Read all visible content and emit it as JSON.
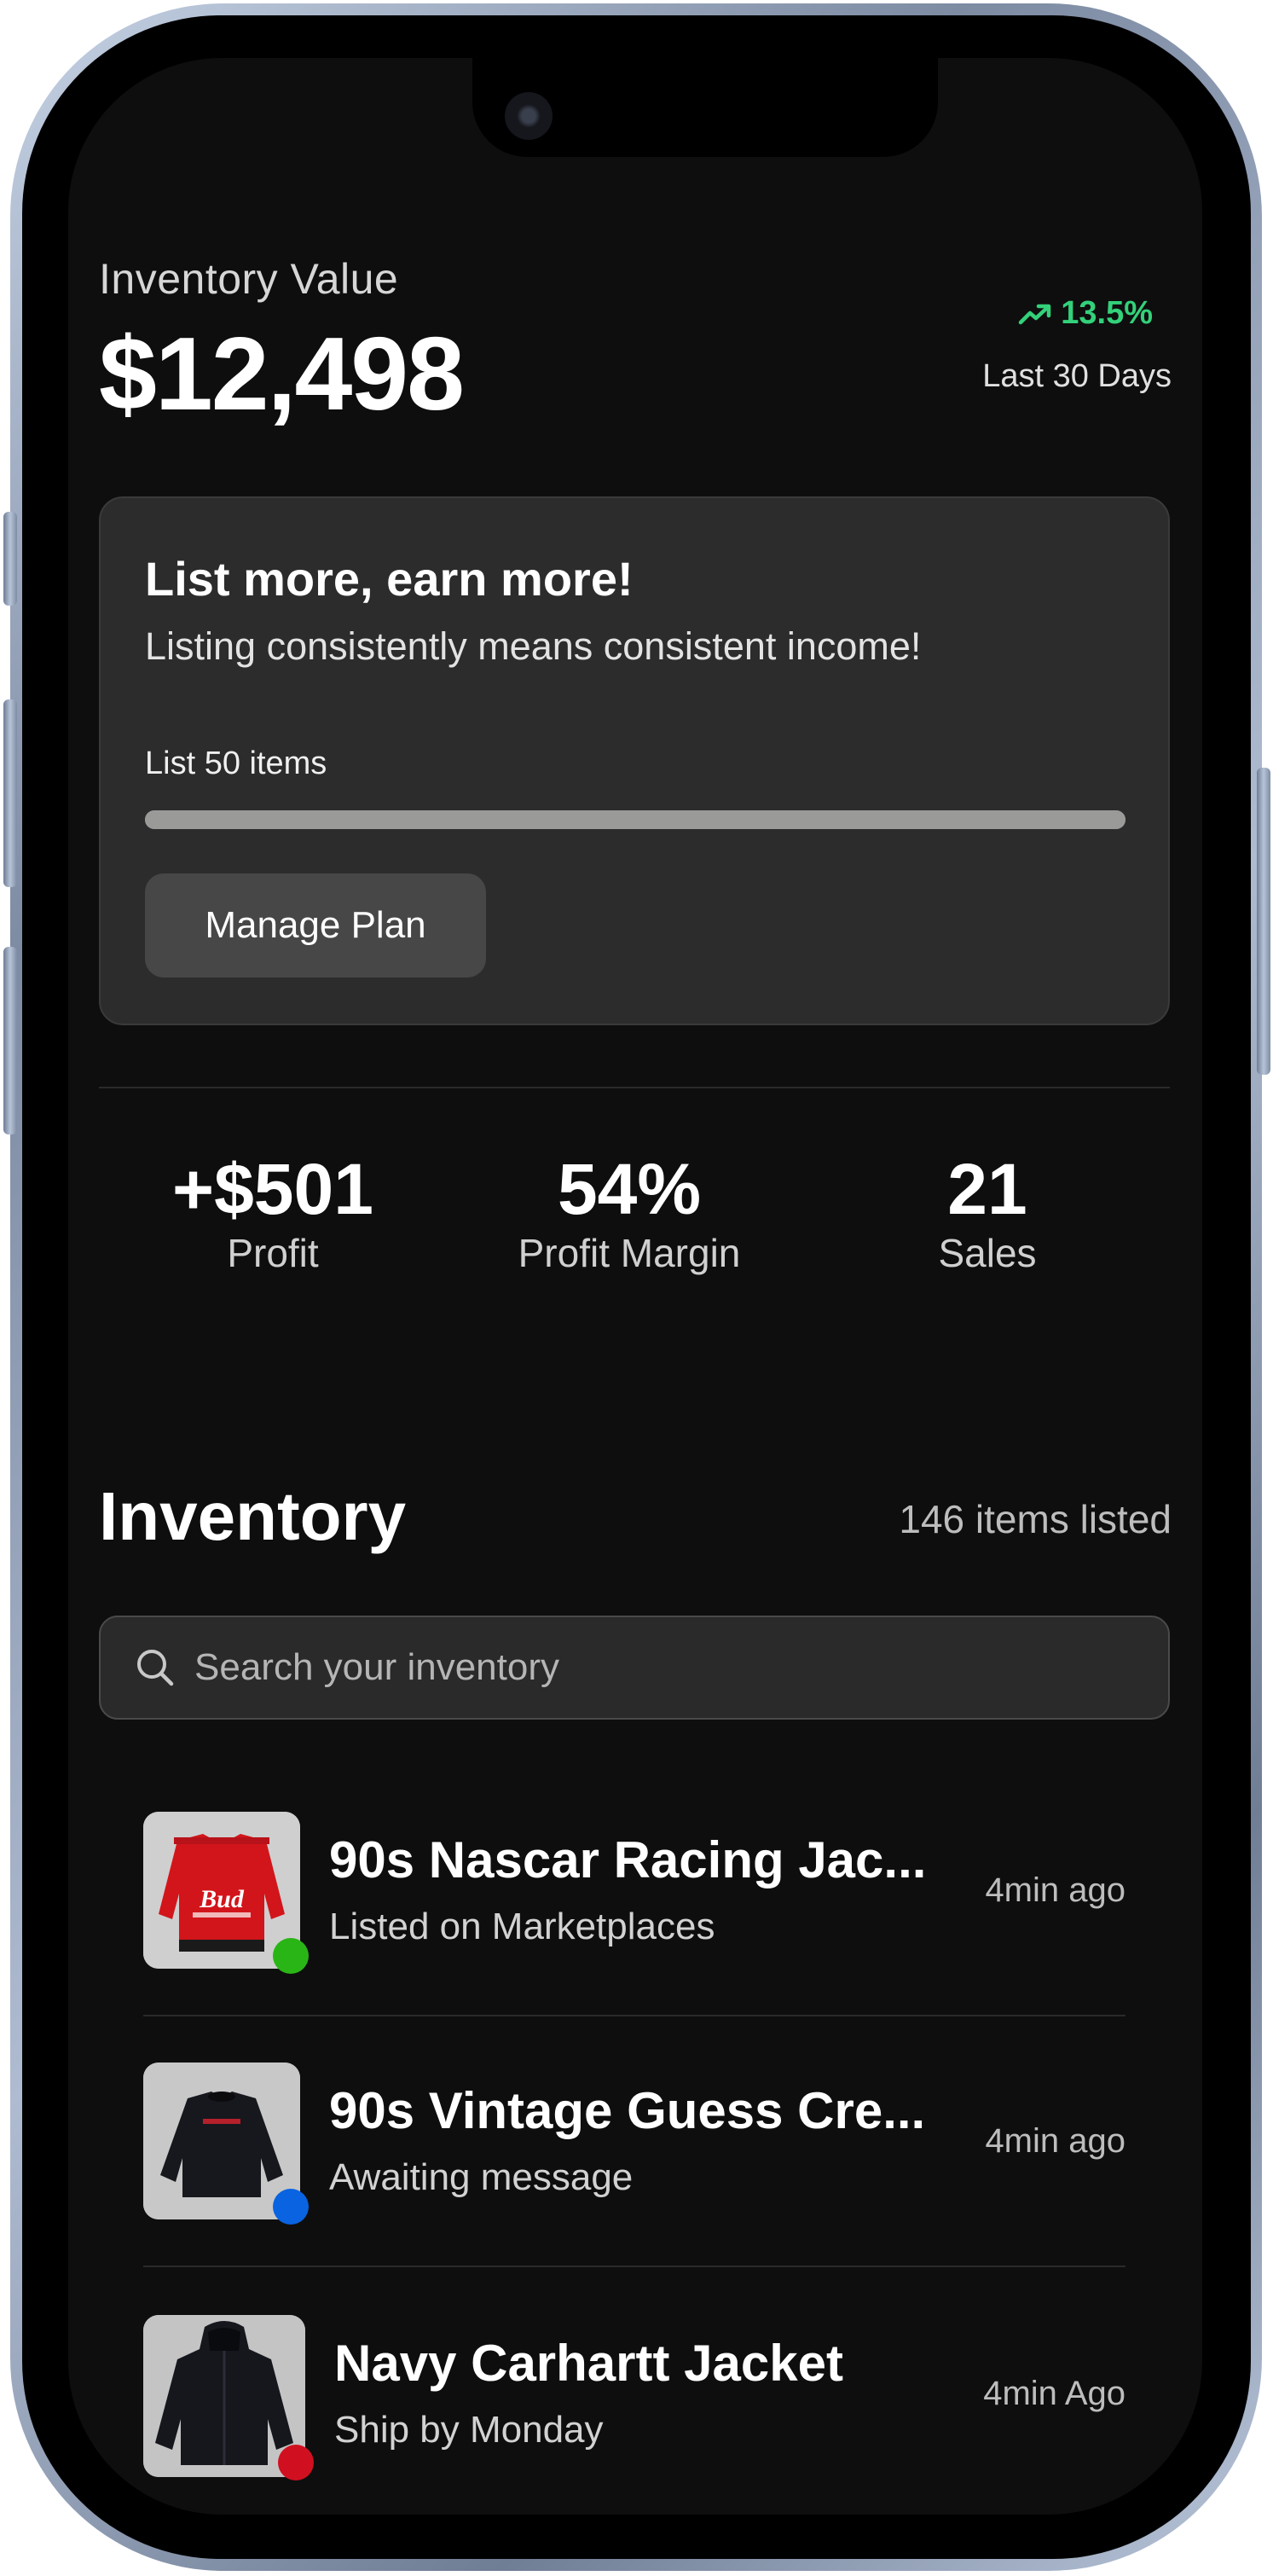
{
  "header": {
    "label": "Inventory Value",
    "value": "$12,498",
    "trend": "13.5%",
    "trend_color": "#33d17a",
    "period": "Last 30 Days"
  },
  "promo": {
    "title": "List more, earn more!",
    "subtitle": "Listing consistently means consistent income!",
    "goal_label": "List 50 items",
    "button_label": "Manage Plan"
  },
  "stats": [
    {
      "value": "+$501",
      "label": "Profit"
    },
    {
      "value": "54%",
      "label": "Profit Margin"
    },
    {
      "value": "21",
      "label": "Sales"
    }
  ],
  "inventory": {
    "heading": "Inventory",
    "count": "146 items listed",
    "search_placeholder": "Search your inventory",
    "items": [
      {
        "title": "90s Nascar Racing Jac...",
        "status": "Listed on Marketplaces",
        "time": "4min ago",
        "status_color": "#2ab516",
        "thumb": "red-racing-jacket"
      },
      {
        "title": "90s Vintage Guess Cre...",
        "status": "Awaiting message",
        "time": "4min ago",
        "status_color": "#0a63e0",
        "thumb": "black-crewneck"
      },
      {
        "title": "Navy Carhartt Jacket",
        "status": "Ship by Monday",
        "time": "4min Ago",
        "status_color": "#d01020",
        "thumb": "navy-hooded-jacket"
      }
    ]
  }
}
